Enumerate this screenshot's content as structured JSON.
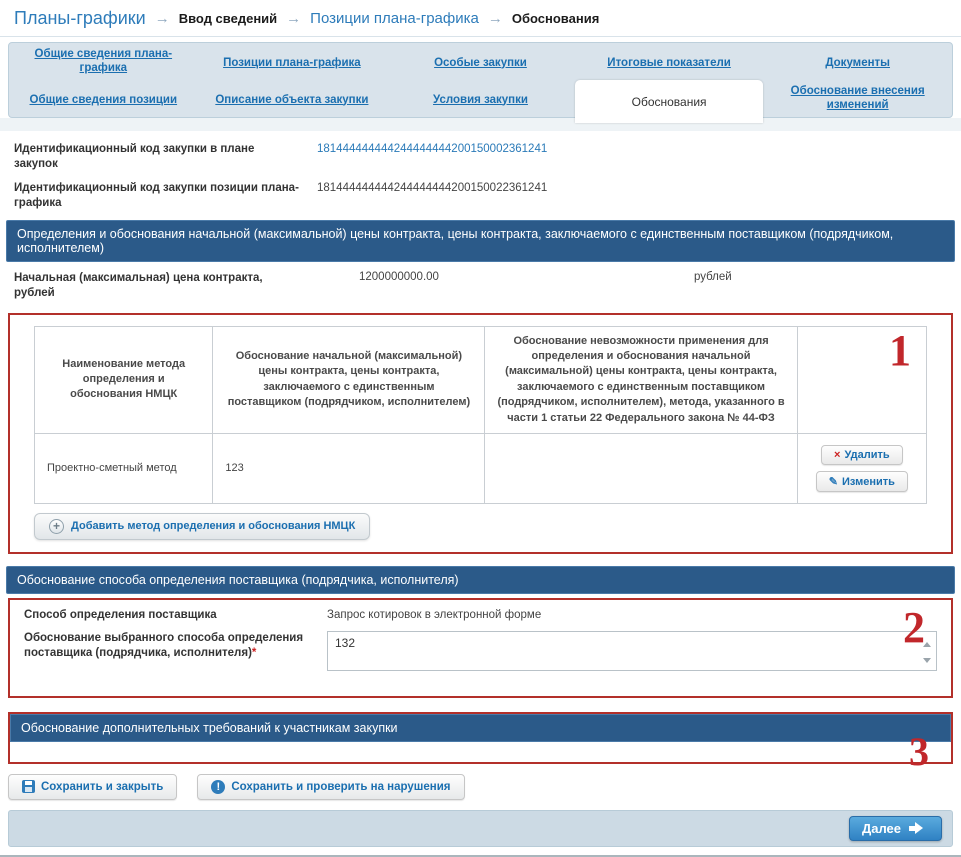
{
  "breadcrumb": {
    "separator": "→",
    "items": [
      {
        "label": "Планы-графики"
      },
      {
        "label": "Ввод сведений"
      },
      {
        "label": "Позиции плана-графика"
      },
      {
        "label": "Обоснования"
      }
    ]
  },
  "tabs": {
    "row1": [
      "Общие сведения плана-графика",
      "Позиции плана-графика",
      "Особые закупки",
      "Итоговые показатели",
      "Документы"
    ],
    "row2": [
      "Общие сведения позиции",
      "Описание объекта закупки",
      "Условия закупки",
      "Обоснования",
      "Обоснование внесения изменений"
    ]
  },
  "id_fields": [
    {
      "label": "Идентификационный код закупки в плане закупок",
      "value": "181444444444244444444200150002361241"
    },
    {
      "label": "Идентификационный код закупки позиции плана-графика",
      "value": "181444444444244444444200150022361241"
    }
  ],
  "section_nmck": {
    "title": "Определения и обоснования начальной (максимальной) цены контракта, цены контракта, заключаемого с единственным поставщиком (подрядчиком, исполнителем)",
    "price_label": "Начальная (максимальная) цена контракта, рублей",
    "price_value": "1200000000.00",
    "price_unit": "рублей",
    "table": {
      "headers": [
        "Наименование метода определения и обоснования НМЦК",
        "Обоснование начальной (максимальной) цены контракта, цены контракта, заключаемого с единственным поставщиком (подрядчиком, исполнителем)",
        "Обоснование невозможности применения для определения и обоснования начальной (максимальной) цены контракта, цены контракта, заключаемого с единственным поставщиком (подрядчиком, исполнителем), метода, указанного в части 1 статьи 22 Федерального закона № 44-ФЗ"
      ],
      "row": {
        "method": "Проектно-сметный метод",
        "justification": "123",
        "impossibility": ""
      },
      "delete_label": "Удалить",
      "edit_label": "Изменить"
    },
    "add_button_label": "Добавить метод определения и обоснования НМЦК"
  },
  "section_supplier": {
    "title": "Обоснование способа определения поставщика (подрядчика, исполнителя)",
    "method_label": "Способ определения поставщика",
    "method_value": "Запрос котировок в электронной форме",
    "justification_label": "Обоснование выбранного способа определения поставщика (подрядчика, исполнителя)",
    "required_mark": "*",
    "justification_value": "132"
  },
  "section_additional": {
    "title": "Обоснование дополнительных требований к участникам закупки"
  },
  "footer": {
    "save_close_label": "Сохранить и закрыть",
    "save_check_label": "Сохранить и проверить на нарушения",
    "next_label": "Далее"
  },
  "annotations": {
    "n1": "1",
    "n2": "2",
    "n3": "3"
  },
  "icons": {
    "delete_x": "×",
    "edit_pencil": "✎",
    "plus": "+",
    "exclamation": "!"
  },
  "colors": {
    "header_bar": "#2b5a89",
    "link": "#1b6fb0",
    "annotation_red": "#b3302a",
    "next_button": "#2f81c3"
  }
}
